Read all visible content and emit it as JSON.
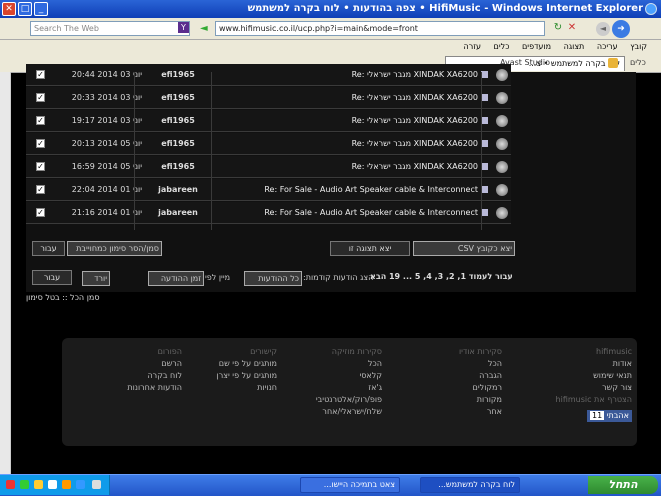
{
  "window": {
    "title": "HifiMusic - Windows Internet Explorer • צפה בהודעות • לוח בקרה למשתמש"
  },
  "address": {
    "url": "www.hifimusic.co.il/ucp.php?i=main&mode=front",
    "search_placeholder": "Search The Web"
  },
  "menubar": {
    "items": [
      "קובץ",
      "עריכה",
      "תצוגה",
      "מועדפים",
      "כלים",
      "עזרה"
    ]
  },
  "favbar": {
    "tab_label": "לוח בקרה למשתמש • צ...",
    "tab2_label": "Avast Studio",
    "tools_label": "כלים"
  },
  "rows": [
    {
      "date": "20:44 2014 יוני 03",
      "user": "efi1965",
      "subject": "Re: מגבר ישראלי XINDAK XA6200"
    },
    {
      "date": "20:33 2014 יוני 03",
      "user": "efi1965",
      "subject": "Re: מגבר ישראלי XINDAK XA6200"
    },
    {
      "date": "19:17 2014 יוני 03",
      "user": "efi1965",
      "subject": "Re: מגבר ישראלי XINDAK XA6200"
    },
    {
      "date": "20:13 2014 יוני 05",
      "user": "efi1965",
      "subject": "Re: מגבר ישראלי XINDAK XA6200"
    },
    {
      "date": "16:59 2014 יוני 05",
      "user": "efi1965",
      "subject": "Re: מגבר ישראלי XINDAK XA6200"
    },
    {
      "date": "22:04 2014 יוני 01",
      "user": "jabareen",
      "subject": "Re: For Sale - Audio Art Speaker cable & Interconnect"
    },
    {
      "date": "21:16 2014 יוני 01",
      "user": "jabareen",
      "subject": "Re: For Sale - Audio Art Speaker cable & Interconnect"
    }
  ],
  "actions": {
    "go_label": "עבור",
    "mark_select": "סמן/הסר סימון כמחוייבת",
    "export_button": "יצא תצוגה זו",
    "export_select": "יצא כקובץ CSV"
  },
  "pagination": {
    "text": "עבור לעמוד 1, 2, 3, 4, 5 ... 19 הבא",
    "display_label": "הצג הודעות קודמות:",
    "display_select": "כל ההודעות",
    "sort_label": "מיין לפי",
    "sort_select": "זמן ההודעה",
    "order_select": "יורד",
    "go_label": "עבור"
  },
  "mark_all": "סמן הכל :: בטל סימון",
  "footer": {
    "col1": {
      "title": "hifimusic",
      "items": [
        "אודות",
        "תנאי שימוש",
        "צור קשר",
        "הצטרף את hifimusic"
      ],
      "fb_label": "אהבתי",
      "fb_count": "11"
    },
    "col2": {
      "title": "סקירות אודיו",
      "items": [
        "הכל",
        "הגברה",
        "רמקולים",
        "מקורות",
        "אחר"
      ]
    },
    "col3": {
      "title": "סקירות מוזיקה",
      "items": [
        "הכל",
        "קלאסי",
        "ג'אז",
        "פופ/רוק/אלטרנטיבי",
        "שלח/ישראלי/אחר"
      ]
    },
    "col4": {
      "title": "קישורים",
      "items": [
        "מותגים על פי שם",
        "מותגים על פי יצרן",
        "חנויות"
      ]
    },
    "col5": {
      "title": "הפורום",
      "items": [
        "הרשם",
        "לוח בקרה",
        "הודעות אחרונות"
      ]
    }
  },
  "taskbar": {
    "start": "התחל",
    "task1": "לוח בקרה למשתמש...",
    "task2": "צאט בתמיכה היישו..."
  }
}
